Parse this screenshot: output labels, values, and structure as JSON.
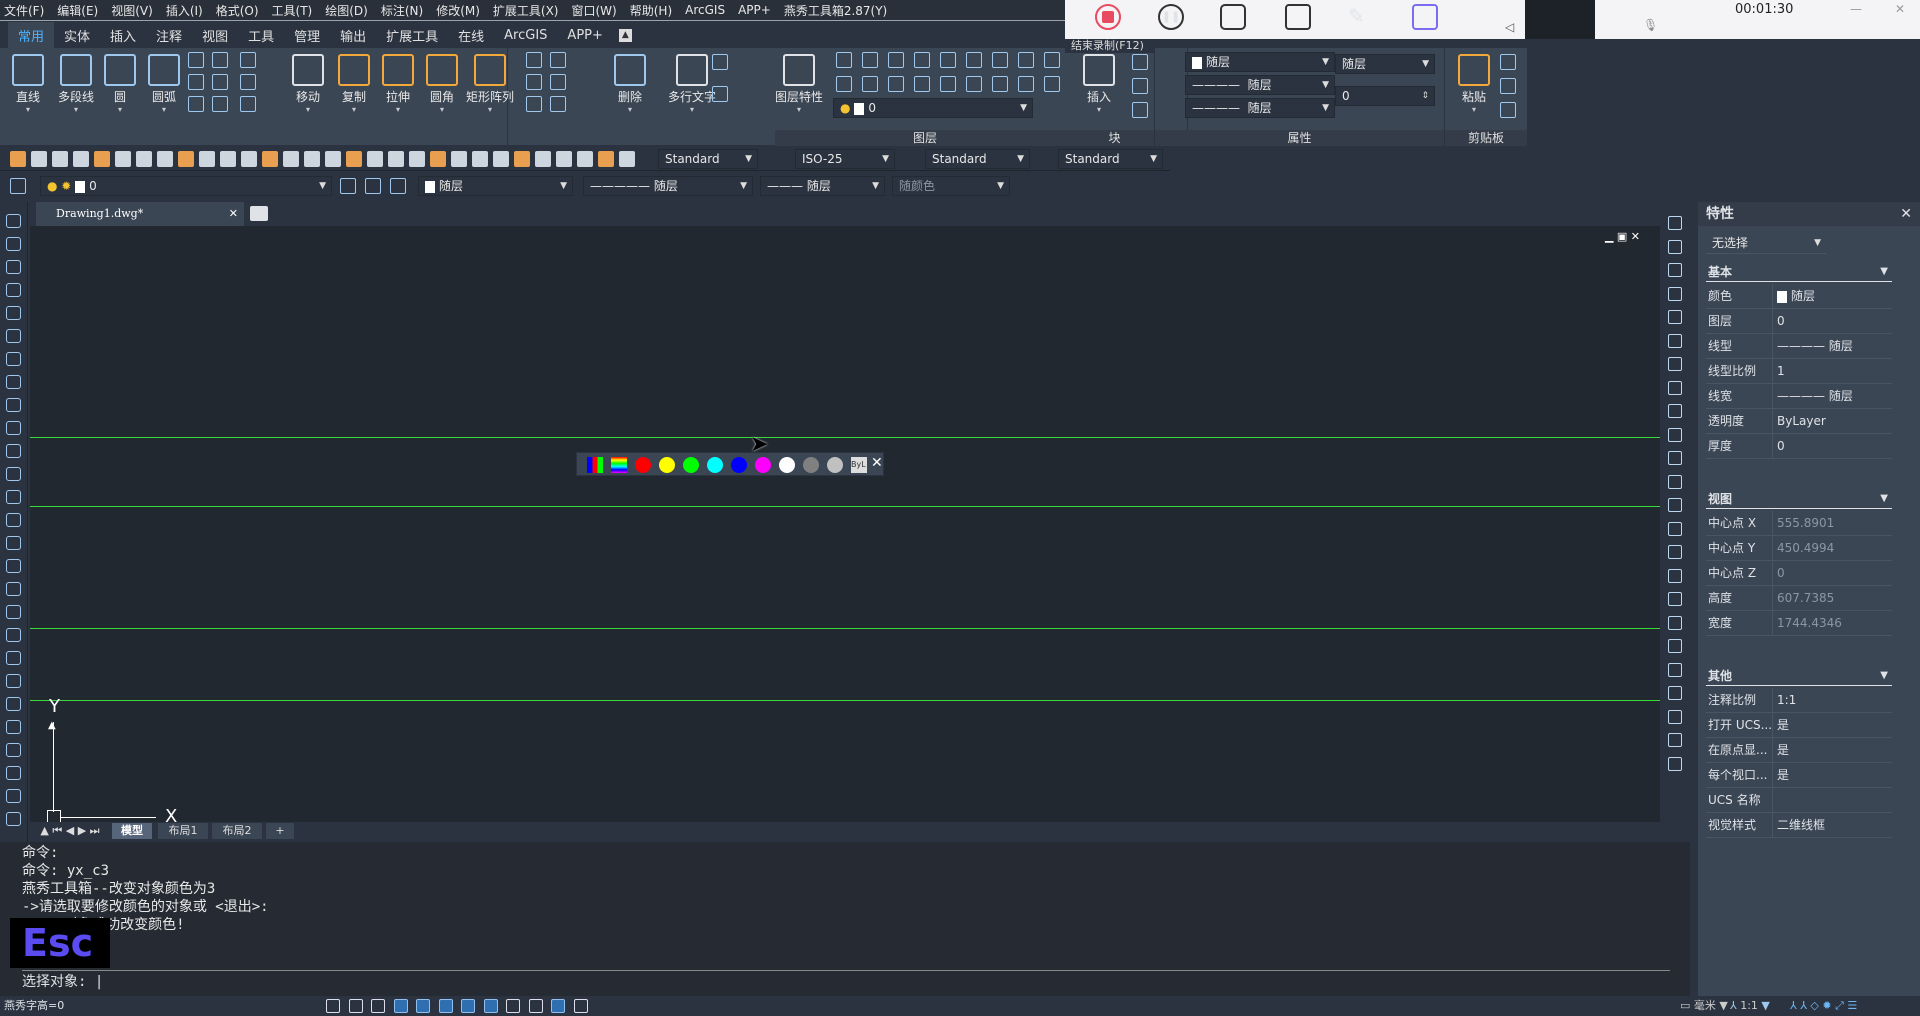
{
  "menu": [
    "文件(F)",
    "编辑(E)",
    "视图(V)",
    "插入(I)",
    "格式(O)",
    "工具(T)",
    "绘图(D)",
    "标注(N)",
    "修改(M)",
    "扩展工具(X)",
    "窗口(W)",
    "帮助(H)",
    "ArcGIS",
    "APP+",
    "燕秀工具箱2.87(Y)"
  ],
  "ribbon_tabs": [
    "常用",
    "实体",
    "插入",
    "注释",
    "视图",
    "工具",
    "管理",
    "输出",
    "扩展工具",
    "在线",
    "ArcGIS",
    "APP+"
  ],
  "ribbon_tools": [
    "直线",
    "多段线",
    "圆",
    "圆弧",
    "移动",
    "复制",
    "拉伸",
    "圆角",
    "矩形阵列",
    "删除",
    "多行文字",
    "图层特性",
    "插入",
    "粘贴"
  ],
  "panel_labels": {
    "layer": "图层",
    "block": "块",
    "properties": "属性",
    "clipboard": "剪贴板"
  },
  "layer_combo": "0",
  "prop_combos": {
    "color": "随层",
    "linetype": "随层",
    "lineweight": "随层",
    "layer": "随层",
    "transparency": "0"
  },
  "styles": {
    "text": "Standard",
    "dim": "ISO-25",
    "table": "Standard",
    "mleader": "Standard"
  },
  "layer_bar": {
    "layer": "0",
    "color": "随层",
    "linetype": "随层",
    "lineweight": "随层",
    "plotstyle": "随颜色"
  },
  "recorder": {
    "time": "00:01:30",
    "tooltip": "结束录制(F12)",
    "accent": "#e84a5f"
  },
  "doc_tab": "Drawing1.dwg*",
  "ucs": {
    "x": "X",
    "y": "Y"
  },
  "palette": {
    "colors": [
      "#ff0000",
      "#ffff00",
      "#00ff00",
      "#00ffff",
      "#0000ff",
      "#ff00ff",
      "#ffffff",
      "#808080",
      "#c0c0c0"
    ],
    "bylayer": "ByL"
  },
  "layout_tabs": [
    "模型",
    "布局1",
    "布局2",
    "+"
  ],
  "command": {
    "history": [
      "命令:",
      "命令: yx_c3",
      "燕秀工具箱--改变对象颜色为3",
      "->请选取要修改颜色的对象或 <退出>:",
      "     对象成功改变颜色!"
    ],
    "prompt": "选择对象: ",
    "esc_overlay": "Esc"
  },
  "status": {
    "left": "燕秀字高=0",
    "units": "毫米",
    "scale": "1:1"
  },
  "properties": {
    "title": "特性",
    "selection": "无选择",
    "sections": [
      {
        "name": "基本",
        "rows": [
          [
            "颜色",
            "随层"
          ],
          [
            "图层",
            "0"
          ],
          [
            "线型",
            "———— 随层"
          ],
          [
            "线型比例",
            "1"
          ],
          [
            "线宽",
            "———— 随层"
          ],
          [
            "透明度",
            "ByLayer"
          ],
          [
            "厚度",
            "0"
          ]
        ]
      },
      {
        "name": "视图",
        "rows": [
          [
            "中心点 X",
            "555.8901"
          ],
          [
            "中心点 Y",
            "450.4994"
          ],
          [
            "中心点 Z",
            "0"
          ],
          [
            "高度",
            "607.7385"
          ],
          [
            "宽度",
            "1744.4346"
          ]
        ]
      },
      {
        "name": "其他",
        "rows": [
          [
            "注释比例",
            "1:1"
          ],
          [
            "打开 UCS...",
            "是"
          ],
          [
            "在原点显...",
            "是"
          ],
          [
            "每个视口...",
            "是"
          ],
          [
            "UCS 名称",
            ""
          ],
          [
            "视觉样式",
            "二维线框"
          ]
        ]
      }
    ]
  }
}
